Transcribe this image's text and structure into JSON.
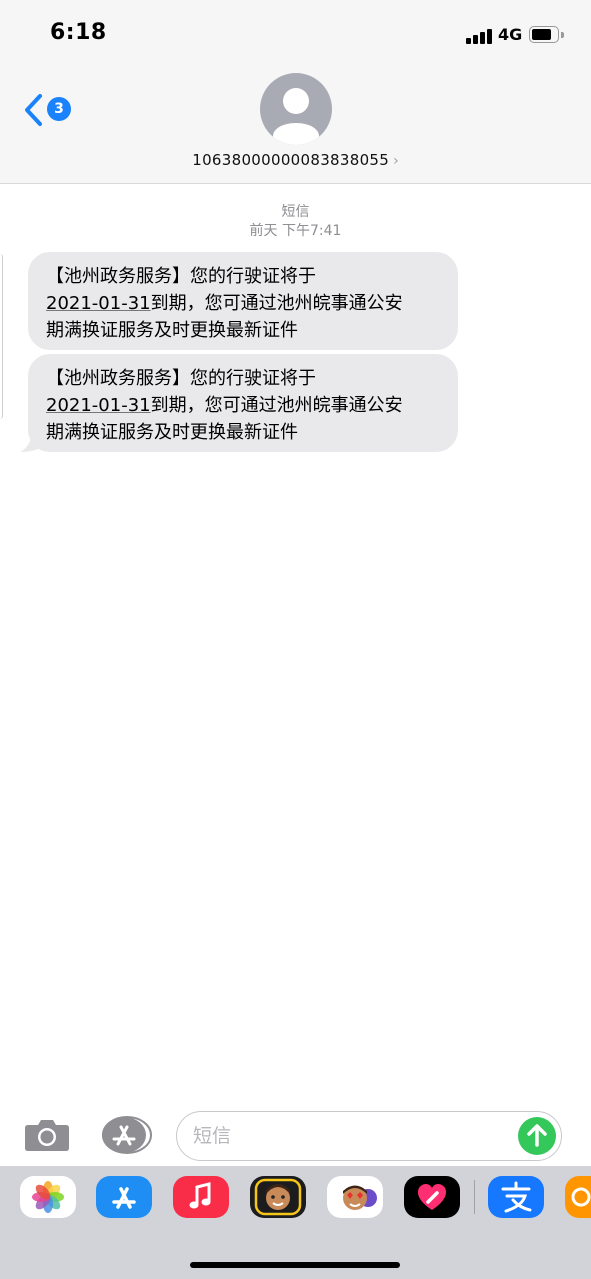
{
  "status_bar": {
    "time": "6:18",
    "network": "4G",
    "battery_level": 0.8
  },
  "header": {
    "back_badge": "3",
    "contact_number": "10638000000083838055"
  },
  "conversation": {
    "service_label": "短信",
    "timestamp": "前天 下午7:41",
    "messages": [
      {
        "line1": "【池州政务服务】您的行驶证将于",
        "date": "2021-01-31",
        "line2_rest": "到期，您可通过池州皖事通公安",
        "line3": "期满换证服务及时更换最新证件"
      },
      {
        "line1": "【池州政务服务】您的行驶证将于",
        "date": "2021-01-31",
        "line2_rest": "到期，您可通过池州皖事通公安",
        "line3": "期满换证服务及时更换最新证件"
      }
    ]
  },
  "input_bar": {
    "placeholder": "短信"
  },
  "app_drawer": {
    "apps": [
      "photos-icon",
      "app-store-icon",
      "music-icon",
      "memoji-icon",
      "animoji-icon",
      "digital-touch-icon",
      "alipay-icon",
      "partial-app-icon"
    ]
  },
  "colors": {
    "accent": "#1a82fb",
    "bubble": "#e9e9eb",
    "send": "#34c759",
    "drawer": "#d1d3d9"
  }
}
